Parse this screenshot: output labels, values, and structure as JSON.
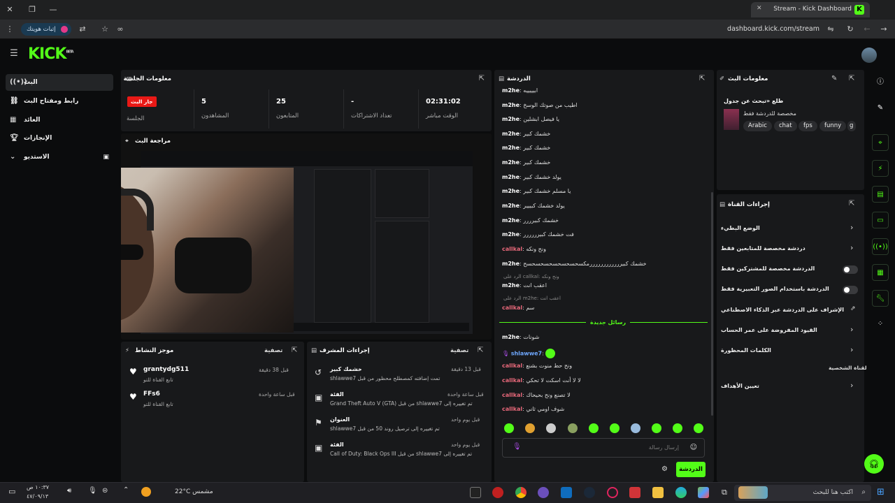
{
  "browser": {
    "tab_title": "Stream - Kick Dashboard",
    "url": "dashboard.kick.com/stream",
    "identity_pill": "إثبات هويتك"
  },
  "sidebar": {
    "items": [
      {
        "label": "البث",
        "icon": "broadcast-icon"
      },
      {
        "label": "رابط ومفتاح البث",
        "icon": "link-icon"
      },
      {
        "label": "العائد",
        "icon": "revenue-icon"
      },
      {
        "label": "الإنجازات",
        "icon": "trophy-icon"
      },
      {
        "label": "الاستديو",
        "icon": "studio-icon"
      }
    ]
  },
  "session": {
    "title": "معلومات الجلسة",
    "live_badge": "جار البث",
    "session_label": "الجلسة",
    "stats": [
      {
        "value": "02:31:02",
        "label": "الوقت مباشر"
      },
      {
        "value": "-",
        "label": "تعداد الاشتراكات"
      },
      {
        "value": "25",
        "label": "المتابعون"
      },
      {
        "value": "5",
        "label": "المشاهدون"
      }
    ]
  },
  "preview": {
    "title": "مراجعة البث"
  },
  "chat": {
    "title": "الدردشة",
    "messages": [
      {
        "user": "m2he",
        "text": "ابيييييه",
        "color": "white"
      },
      {
        "user": "m2he",
        "text": "اطيب من صوتك الوسخ",
        "color": "white"
      },
      {
        "user": "m2he",
        "text": "يا فيصل ابشلين",
        "color": "white"
      },
      {
        "user": "m2he",
        "text": "خشمك كبير",
        "color": "white"
      },
      {
        "user": "m2he",
        "text": "خشمك كبير",
        "color": "white"
      },
      {
        "user": "m2he",
        "text": "خشمك كبير",
        "color": "white"
      },
      {
        "user": "m2he",
        "text": "يولد خشمك كبير",
        "color": "white"
      },
      {
        "user": "m2he",
        "text": "يا مسلم خشمك كبير",
        "color": "white"
      },
      {
        "user": "m2he",
        "text": "يولد خشمك كبييير",
        "color": "white"
      },
      {
        "user": "m2he",
        "text": "خشمك كبيرررر",
        "color": "white"
      },
      {
        "user": "m2he",
        "text": "فت خشمك كبيرررررر",
        "color": "white"
      },
      {
        "user": "callkal",
        "text": "ونح ونكه",
        "color": "red"
      },
      {
        "user": "m2he",
        "text": "خشمك كبيررررررررررررمكسحسحسحسحسحسحسح",
        "color": "white"
      },
      {
        "user": "m2he",
        "text": "اعقب انت",
        "color": "white",
        "reply": "الرد على callkal: ونح ونكه"
      },
      {
        "user": "callkal",
        "text": "سم",
        "color": "red",
        "reply": "الرد على m2he: اعقب انت"
      },
      {
        "user": "m2he",
        "text": "شونات",
        "color": "white"
      },
      {
        "user": "shlawwe7",
        "text": "",
        "color": "blue"
      },
      {
        "user": "callkal",
        "text": "ونح حط منوت بشنع",
        "color": "red"
      },
      {
        "user": "callkal",
        "text": "لا لا أنت اسكت لا تحكي",
        "color": "red"
      },
      {
        "user": "callkal",
        "text": "لا تصنع ونح بحيحاك",
        "color": "red"
      },
      {
        "user": "callkal",
        "text": "شوف اومي ثاني",
        "color": "red"
      }
    ],
    "new_messages_label": "رسائل جديدة",
    "input_placeholder": "إرسال رسالة",
    "send_label": "الدردشة"
  },
  "stream_info": {
    "title": "معلومات البث",
    "stream_title": "طلع «تبحث عن جدول",
    "category": "مخصصة للدردشة فقط",
    "tags": [
      "Arabic",
      "chat",
      "fps",
      "funny",
      "g"
    ]
  },
  "channel_actions": {
    "title": "إجراءات القناة",
    "rows": [
      {
        "label": "الوضع البطيء",
        "control": "chevron"
      },
      {
        "label": "دردشة مخصصة للمتابعين فقط",
        "control": "chevron"
      },
      {
        "label": "الدردشة مخصصة للمشتركين فقط",
        "control": "toggle"
      },
      {
        "label": "الدردشة باستخدام الصور التعبيرية فقط",
        "control": "toggle"
      },
      {
        "label": "الإشراف على الدردشة عبر الذكاء الاصطناعي",
        "control": "external"
      },
      {
        "label": "القيود المفروضة على عمر الحساب",
        "control": "chevron"
      },
      {
        "label": "الكلمات المحظورة",
        "control": "chevron"
      },
      {
        "label": "تعيين الأهداف",
        "control": "chevron"
      }
    ],
    "section_label": "القناة الشخصية"
  },
  "activity": {
    "title": "موجز النشاط",
    "filter_label": "تصفية",
    "items": [
      {
        "user": "grantydg511",
        "desc": "تابع القناة للتو",
        "time": "قبل 38 دقيقة"
      },
      {
        "user": "FFs6",
        "desc": "تابع القناة للتو",
        "time": "قبل ساعة واحدة"
      }
    ]
  },
  "mod_actions": {
    "title": "إجراءات المشرف",
    "filter_label": "تصفية",
    "items": [
      {
        "heading": "خشمك كبير",
        "desc": "shlawwe7 تمت إضافته كمصطلح محظور من قبل",
        "time": "قبل 13 دقيقة"
      },
      {
        "heading": "الفئة",
        "desc": "Grand Theft Auto V (GTA) من قبل shlawwe7 تم تغييره إلى",
        "time": "قبل ساعة واحدة"
      },
      {
        "heading": "العنوان",
        "desc": "shlawwe7 تم تغييره إلى ترصيل روند 50 من قبل",
        "time": "قبل يوم واحد"
      },
      {
        "heading": "الفئة",
        "desc": "Call of Duty: Black Ops III من قبل shlawwe7 تم تغييره إلى",
        "time": "قبل يوم واحد"
      }
    ]
  },
  "taskbar": {
    "search_placeholder": "اكتب هنا للبحث",
    "weather": "22°C مشمس",
    "clock_time": "١٠:٣٧ ص",
    "clock_date": "٤٧/٠٩/١٣"
  }
}
